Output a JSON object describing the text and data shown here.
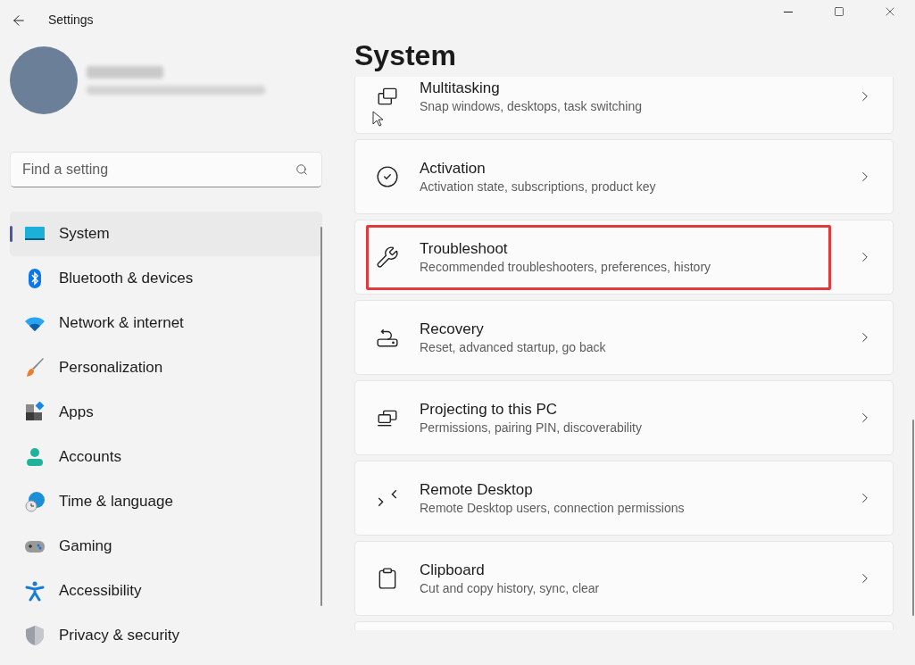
{
  "window": {
    "title": "Settings"
  },
  "search": {
    "placeholder": "Find a setting"
  },
  "sidebar": {
    "items": [
      {
        "label": "System",
        "selected": true
      },
      {
        "label": "Bluetooth & devices",
        "selected": false
      },
      {
        "label": "Network & internet",
        "selected": false
      },
      {
        "label": "Personalization",
        "selected": false
      },
      {
        "label": "Apps",
        "selected": false
      },
      {
        "label": "Accounts",
        "selected": false
      },
      {
        "label": "Time & language",
        "selected": false
      },
      {
        "label": "Gaming",
        "selected": false
      },
      {
        "label": "Accessibility",
        "selected": false
      },
      {
        "label": "Privacy & security",
        "selected": false
      }
    ]
  },
  "page": {
    "title": "System",
    "items": [
      {
        "title": "Multitasking",
        "description": "Snap windows, desktops, task switching",
        "highlighted": false
      },
      {
        "title": "Activation",
        "description": "Activation state, subscriptions, product key",
        "highlighted": false
      },
      {
        "title": "Troubleshoot",
        "description": "Recommended troubleshooters, preferences, history",
        "highlighted": true
      },
      {
        "title": "Recovery",
        "description": "Reset, advanced startup, go back",
        "highlighted": false
      },
      {
        "title": "Projecting to this PC",
        "description": "Permissions, pairing PIN, discoverability",
        "highlighted": false
      },
      {
        "title": "Remote Desktop",
        "description": "Remote Desktop users, connection permissions",
        "highlighted": false
      },
      {
        "title": "Clipboard",
        "description": "Cut and copy history, sync, clear",
        "highlighted": false
      }
    ]
  }
}
